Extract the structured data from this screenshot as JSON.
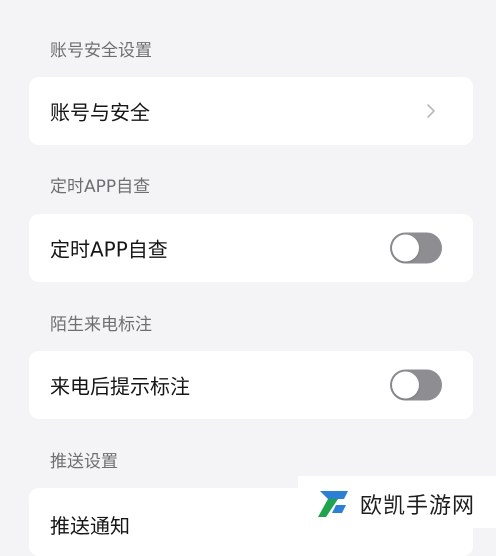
{
  "sections": [
    {
      "header": "账号安全设置",
      "row_label": "账号与安全",
      "control": "chevron-right-icon"
    },
    {
      "header": "定时APP自查",
      "row_label": "定时APP自查",
      "control": "toggle",
      "enabled": false
    },
    {
      "header": "陌生来电标注",
      "row_label": "来电后提示标注",
      "control": "toggle",
      "enabled": false
    },
    {
      "header": "推送设置",
      "row_label": "推送通知"
    }
  ],
  "watermark": {
    "text": "欧凯手游网"
  },
  "colors": {
    "background": "#f4f4f6",
    "card": "#ffffff",
    "toggle_off": "#8d8d92",
    "logo_blue": "#2b7fd4",
    "logo_green": "#1fa34d"
  }
}
